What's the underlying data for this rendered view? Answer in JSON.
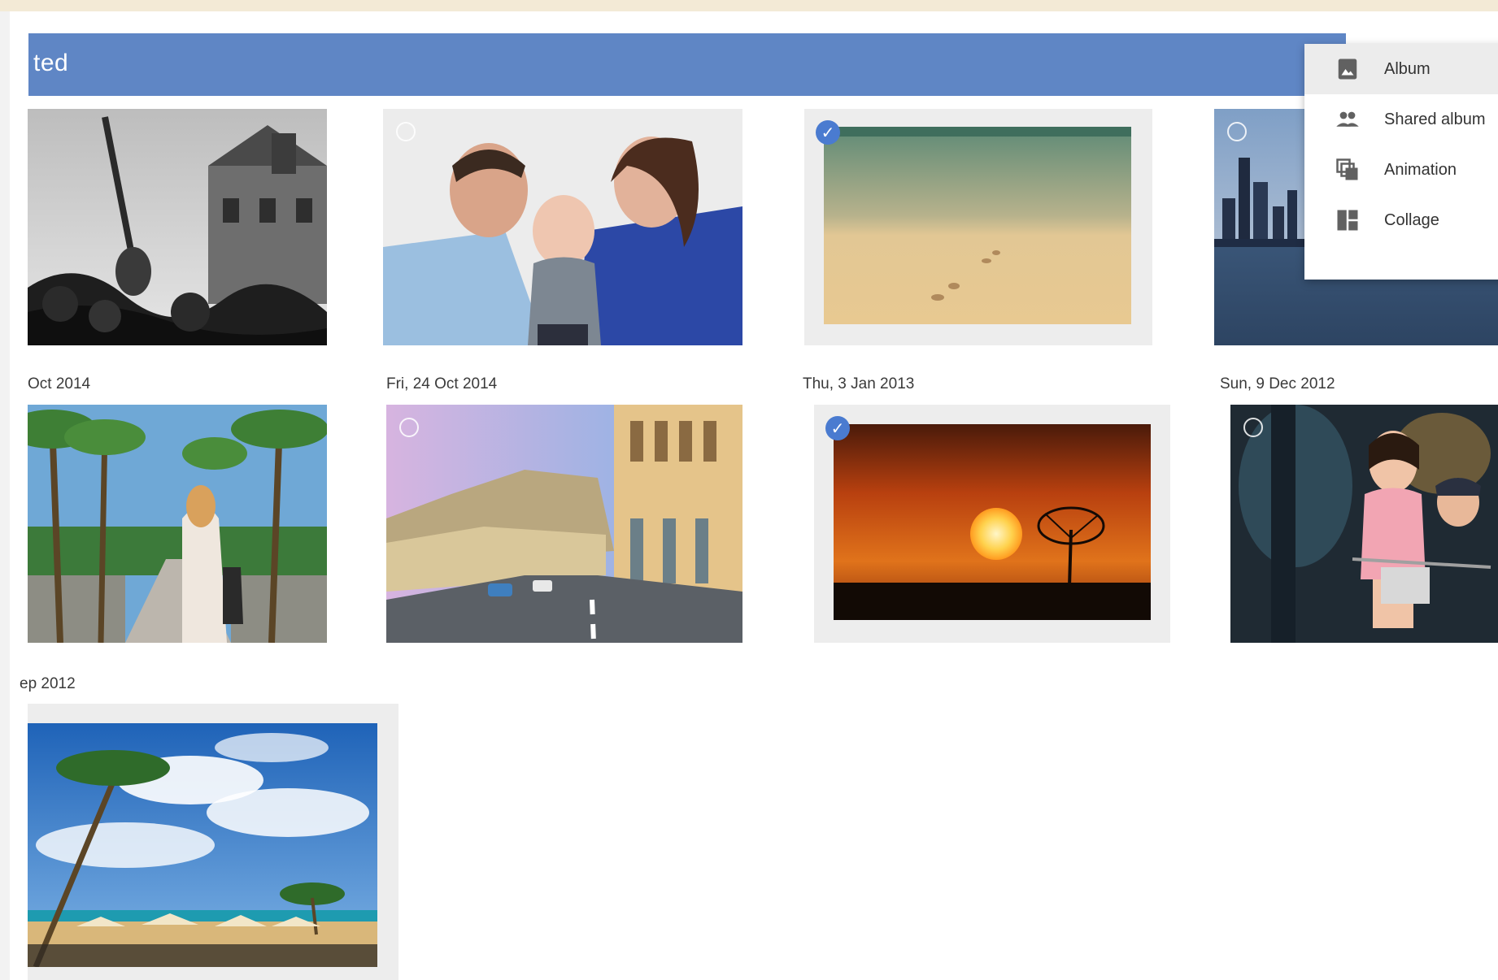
{
  "header": {
    "title": "ted",
    "accent_color": "#5f86c5"
  },
  "date_labels": {
    "row1_col1": "Oct 2014",
    "row1_col2": "Fri, 24 Oct 2014",
    "row1_col3": "Thu, 3 Jan 2013",
    "row1_col4": "Sun, 9 Dec 2012",
    "row2_col1": "ep 2012"
  },
  "photos": [
    {
      "id": "concert",
      "subject": "black and white concert crowd",
      "selected": false
    },
    {
      "id": "family",
      "subject": "family with baby",
      "selected": false
    },
    {
      "id": "beach-footprints",
      "subject": "footprints on beach",
      "selected": true
    },
    {
      "id": "city-skyline",
      "subject": "city skyline over water",
      "selected": false
    },
    {
      "id": "palm-avenue",
      "subject": "woman on palm tree avenue",
      "selected": false
    },
    {
      "id": "street-town",
      "subject": "coastal town street",
      "selected": false
    },
    {
      "id": "sunset",
      "subject": "sunset with tree silhouette",
      "selected": true
    },
    {
      "id": "children-bike",
      "subject": "children on bicycle",
      "selected": false
    },
    {
      "id": "tropical-beach",
      "subject": "tropical beach with palm",
      "selected": false
    }
  ],
  "create_menu": {
    "items": [
      {
        "label": "Album",
        "icon": "album-icon",
        "active": true
      },
      {
        "label": "Shared album",
        "icon": "shared-album-icon",
        "active": false
      },
      {
        "label": "Animation",
        "icon": "animation-icon",
        "active": false
      },
      {
        "label": "Collage",
        "icon": "collage-icon",
        "active": false
      }
    ]
  }
}
